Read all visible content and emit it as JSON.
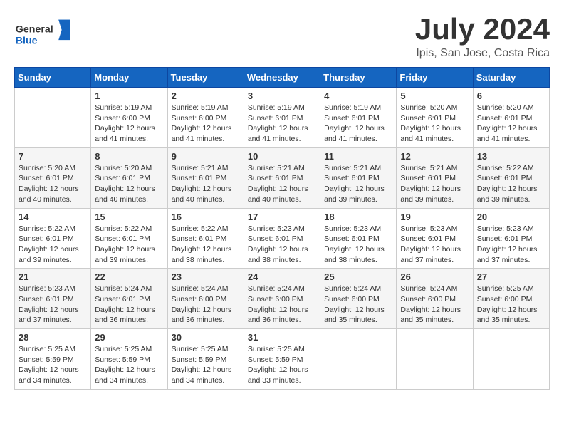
{
  "header": {
    "logo_general": "General",
    "logo_blue": "Blue",
    "month_title": "July 2024",
    "location": "Ipis, San Jose, Costa Rica"
  },
  "days_of_week": [
    "Sunday",
    "Monday",
    "Tuesday",
    "Wednesday",
    "Thursday",
    "Friday",
    "Saturday"
  ],
  "weeks": [
    [
      {
        "day": "",
        "info": ""
      },
      {
        "day": "1",
        "info": "Sunrise: 5:19 AM\nSunset: 6:00 PM\nDaylight: 12 hours\nand 41 minutes."
      },
      {
        "day": "2",
        "info": "Sunrise: 5:19 AM\nSunset: 6:00 PM\nDaylight: 12 hours\nand 41 minutes."
      },
      {
        "day": "3",
        "info": "Sunrise: 5:19 AM\nSunset: 6:01 PM\nDaylight: 12 hours\nand 41 minutes."
      },
      {
        "day": "4",
        "info": "Sunrise: 5:19 AM\nSunset: 6:01 PM\nDaylight: 12 hours\nand 41 minutes."
      },
      {
        "day": "5",
        "info": "Sunrise: 5:20 AM\nSunset: 6:01 PM\nDaylight: 12 hours\nand 41 minutes."
      },
      {
        "day": "6",
        "info": "Sunrise: 5:20 AM\nSunset: 6:01 PM\nDaylight: 12 hours\nand 41 minutes."
      }
    ],
    [
      {
        "day": "7",
        "info": "Sunrise: 5:20 AM\nSunset: 6:01 PM\nDaylight: 12 hours\nand 40 minutes."
      },
      {
        "day": "8",
        "info": "Sunrise: 5:20 AM\nSunset: 6:01 PM\nDaylight: 12 hours\nand 40 minutes."
      },
      {
        "day": "9",
        "info": "Sunrise: 5:21 AM\nSunset: 6:01 PM\nDaylight: 12 hours\nand 40 minutes."
      },
      {
        "day": "10",
        "info": "Sunrise: 5:21 AM\nSunset: 6:01 PM\nDaylight: 12 hours\nand 40 minutes."
      },
      {
        "day": "11",
        "info": "Sunrise: 5:21 AM\nSunset: 6:01 PM\nDaylight: 12 hours\nand 39 minutes."
      },
      {
        "day": "12",
        "info": "Sunrise: 5:21 AM\nSunset: 6:01 PM\nDaylight: 12 hours\nand 39 minutes."
      },
      {
        "day": "13",
        "info": "Sunrise: 5:22 AM\nSunset: 6:01 PM\nDaylight: 12 hours\nand 39 minutes."
      }
    ],
    [
      {
        "day": "14",
        "info": "Sunrise: 5:22 AM\nSunset: 6:01 PM\nDaylight: 12 hours\nand 39 minutes."
      },
      {
        "day": "15",
        "info": "Sunrise: 5:22 AM\nSunset: 6:01 PM\nDaylight: 12 hours\nand 39 minutes."
      },
      {
        "day": "16",
        "info": "Sunrise: 5:22 AM\nSunset: 6:01 PM\nDaylight: 12 hours\nand 38 minutes."
      },
      {
        "day": "17",
        "info": "Sunrise: 5:23 AM\nSunset: 6:01 PM\nDaylight: 12 hours\nand 38 minutes."
      },
      {
        "day": "18",
        "info": "Sunrise: 5:23 AM\nSunset: 6:01 PM\nDaylight: 12 hours\nand 38 minutes."
      },
      {
        "day": "19",
        "info": "Sunrise: 5:23 AM\nSunset: 6:01 PM\nDaylight: 12 hours\nand 37 minutes."
      },
      {
        "day": "20",
        "info": "Sunrise: 5:23 AM\nSunset: 6:01 PM\nDaylight: 12 hours\nand 37 minutes."
      }
    ],
    [
      {
        "day": "21",
        "info": "Sunrise: 5:23 AM\nSunset: 6:01 PM\nDaylight: 12 hours\nand 37 minutes."
      },
      {
        "day": "22",
        "info": "Sunrise: 5:24 AM\nSunset: 6:01 PM\nDaylight: 12 hours\nand 36 minutes."
      },
      {
        "day": "23",
        "info": "Sunrise: 5:24 AM\nSunset: 6:00 PM\nDaylight: 12 hours\nand 36 minutes."
      },
      {
        "day": "24",
        "info": "Sunrise: 5:24 AM\nSunset: 6:00 PM\nDaylight: 12 hours\nand 36 minutes."
      },
      {
        "day": "25",
        "info": "Sunrise: 5:24 AM\nSunset: 6:00 PM\nDaylight: 12 hours\nand 35 minutes."
      },
      {
        "day": "26",
        "info": "Sunrise: 5:24 AM\nSunset: 6:00 PM\nDaylight: 12 hours\nand 35 minutes."
      },
      {
        "day": "27",
        "info": "Sunrise: 5:25 AM\nSunset: 6:00 PM\nDaylight: 12 hours\nand 35 minutes."
      }
    ],
    [
      {
        "day": "28",
        "info": "Sunrise: 5:25 AM\nSunset: 5:59 PM\nDaylight: 12 hours\nand 34 minutes."
      },
      {
        "day": "29",
        "info": "Sunrise: 5:25 AM\nSunset: 5:59 PM\nDaylight: 12 hours\nand 34 minutes."
      },
      {
        "day": "30",
        "info": "Sunrise: 5:25 AM\nSunset: 5:59 PM\nDaylight: 12 hours\nand 34 minutes."
      },
      {
        "day": "31",
        "info": "Sunrise: 5:25 AM\nSunset: 5:59 PM\nDaylight: 12 hours\nand 33 minutes."
      },
      {
        "day": "",
        "info": ""
      },
      {
        "day": "",
        "info": ""
      },
      {
        "day": "",
        "info": ""
      }
    ]
  ]
}
